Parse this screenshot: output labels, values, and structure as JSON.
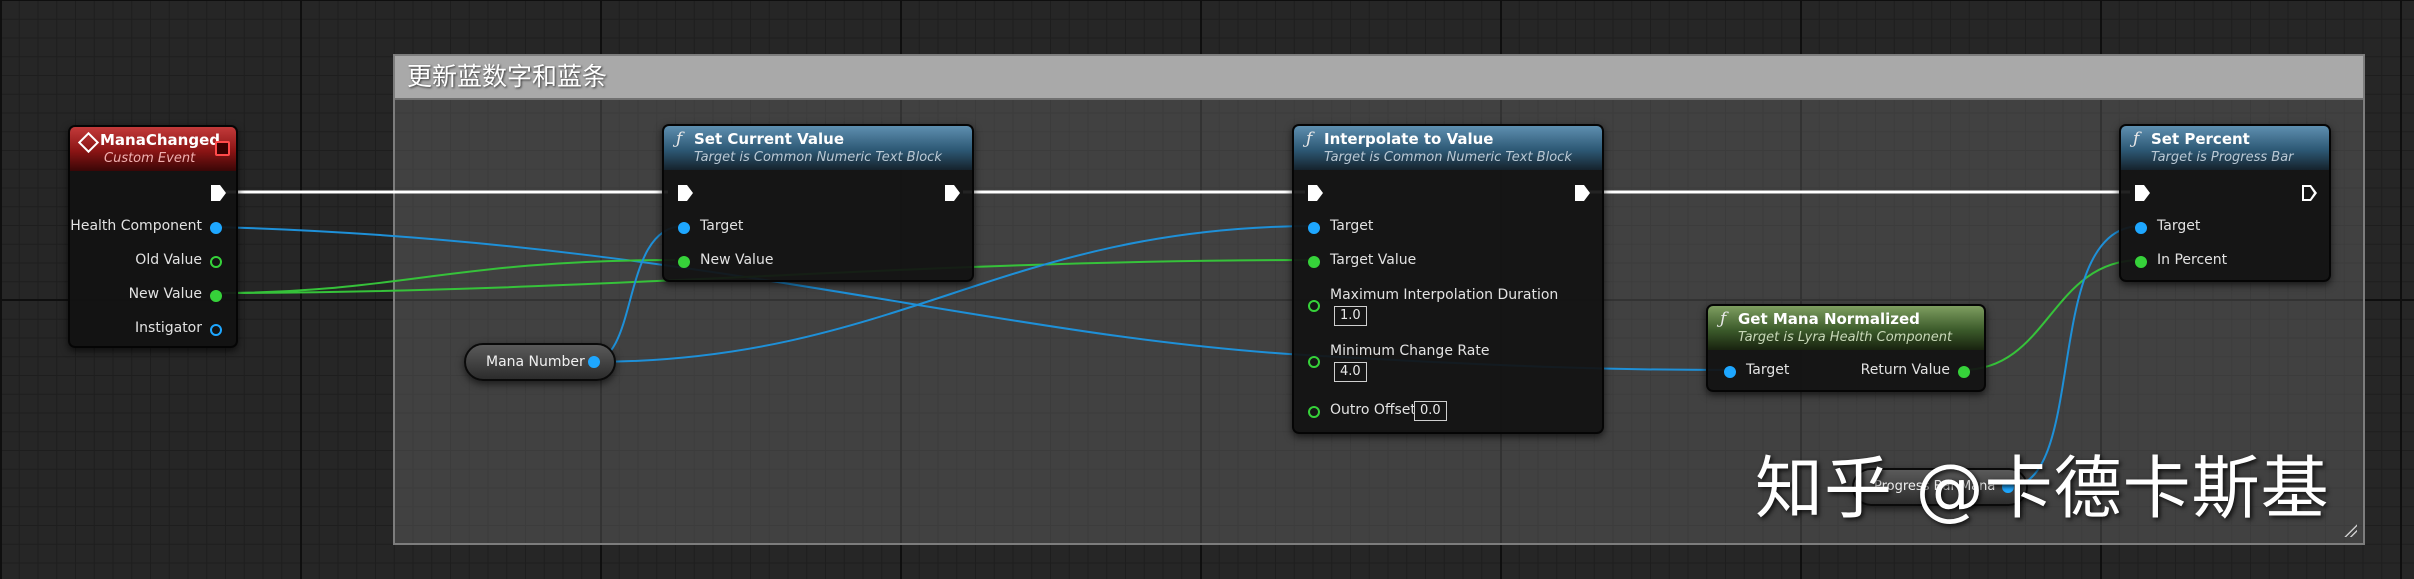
{
  "comment": {
    "title": "更新蓝数字和蓝条"
  },
  "event_node": {
    "title": "ManaChanged",
    "subtitle": "Custom Event",
    "pins": [
      "Health Component",
      "Old Value",
      "New Value",
      "Instigator"
    ]
  },
  "set_current_value": {
    "title": "Set Current Value",
    "subtitle": "Target is Common Numeric Text Block",
    "pins": [
      "Target",
      "New Value"
    ]
  },
  "interpolate": {
    "title": "Interpolate to Value",
    "subtitle": "Target is Common Numeric Text Block",
    "pins": [
      "Target",
      "Target Value",
      "Maximum Interpolation Duration",
      "Minimum Change Rate",
      "Outro Offset"
    ],
    "max_duration": "1.0",
    "min_change_rate": "4.0",
    "outro_offset": "0.0"
  },
  "get_mana_normalized": {
    "title": "Get Mana Normalized",
    "subtitle": "Target is Lyra Health Component",
    "pin_in": "Target",
    "pin_out": "Return Value"
  },
  "set_percent": {
    "title": "Set Percent",
    "subtitle": "Target is Progress Bar",
    "pins": [
      "Target",
      "In Percent"
    ]
  },
  "variables": {
    "mana_number": "Mana Number",
    "progress_bar_mana": "Progress Bar Mana"
  },
  "watermark": "知乎 @卡德卡斯基",
  "colors": {
    "object_pin": "#1ea7ff",
    "float_pin": "#36d23a",
    "exec_pin": "#ffffff",
    "event_header": "#8a1414",
    "function_header": "#2d5874",
    "pure_function_header": "#3b5a2a"
  }
}
